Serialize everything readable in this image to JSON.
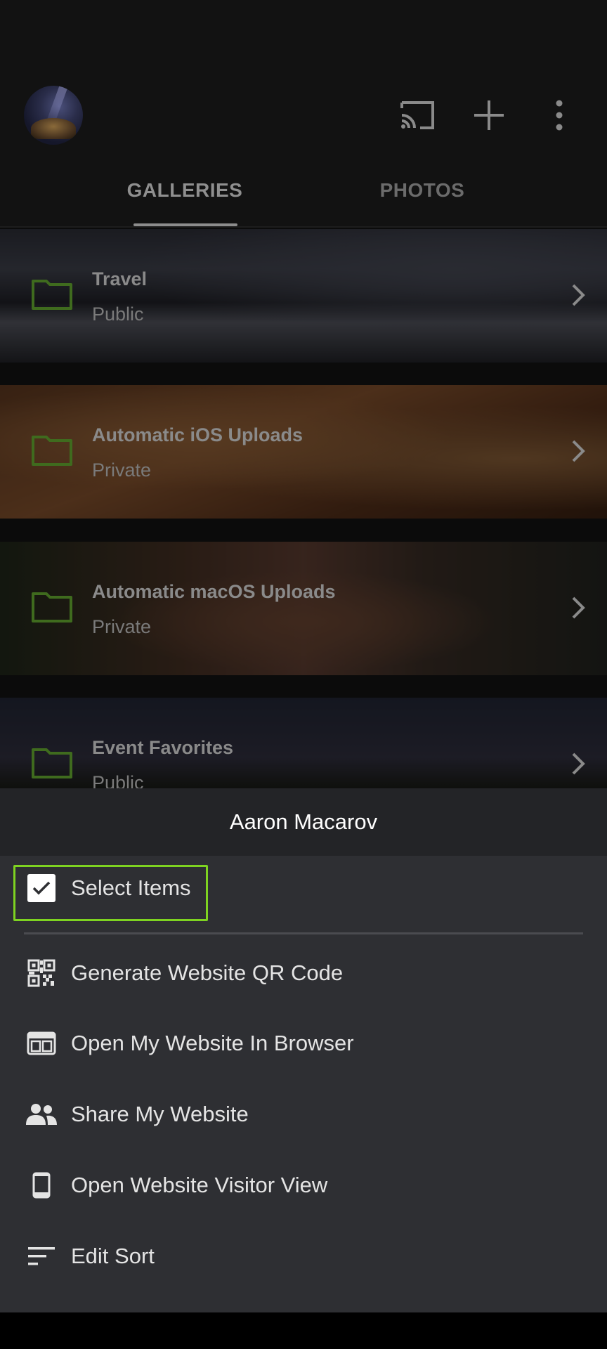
{
  "appbar": {
    "avatar_icon": "profile-avatar",
    "cast_icon": "cast-icon",
    "add_icon": "add-icon",
    "more_icon": "more-vert-icon"
  },
  "tabs": [
    {
      "label": "GALLERIES",
      "selected": true
    },
    {
      "label": "PHOTOS",
      "selected": false
    }
  ],
  "galleries": [
    {
      "title": "Travel",
      "visibility": "Public"
    },
    {
      "title": "Automatic iOS Uploads",
      "visibility": "Private"
    },
    {
      "title": "Automatic macOS Uploads",
      "visibility": "Private"
    },
    {
      "title": "Event Favorites",
      "visibility": "Public"
    }
  ],
  "sheet": {
    "title": "Aaron Macarov",
    "items": [
      {
        "label": "Select Items",
        "icon": "checkbox-icon",
        "highlighted": true
      },
      {
        "label": "Generate Website QR Code",
        "icon": "qr-code-icon"
      },
      {
        "label": "Open My Website In Browser",
        "icon": "browser-icon"
      },
      {
        "label": "Share My Website",
        "icon": "people-icon"
      },
      {
        "label": "Open Website Visitor View",
        "icon": "phone-icon"
      },
      {
        "label": "Edit Sort",
        "icon": "sort-icon"
      }
    ]
  },
  "colors": {
    "accent_green": "#7ed321",
    "folder_green": "#3f6b1e",
    "sheet_bg": "#2e2f33",
    "sheet_header_bg": "#232427"
  }
}
